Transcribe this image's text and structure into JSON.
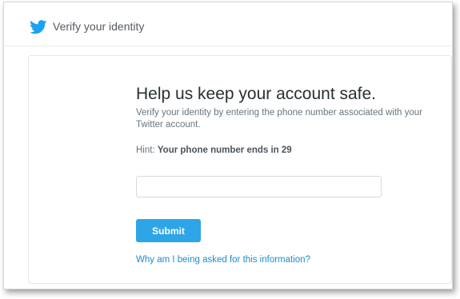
{
  "header": {
    "title": "Verify your identity",
    "logo_icon": "twitter-bird-icon",
    "logo_color": "#1da1f2"
  },
  "main": {
    "headline": "Help us keep your account safe.",
    "description": "Verify your identity by entering the phone number associated with your Twitter account.",
    "hint_label": "Hint:",
    "hint_value": "Your phone number ends in 29",
    "phone_input": {
      "value": "",
      "placeholder": ""
    },
    "submit_label": "Submit",
    "help_link": "Why am I being asked for this information?"
  },
  "colors": {
    "accent": "#2ea5e6",
    "link": "#1b8ccc",
    "text_primary": "#292f33",
    "text_secondary": "#66757f"
  }
}
